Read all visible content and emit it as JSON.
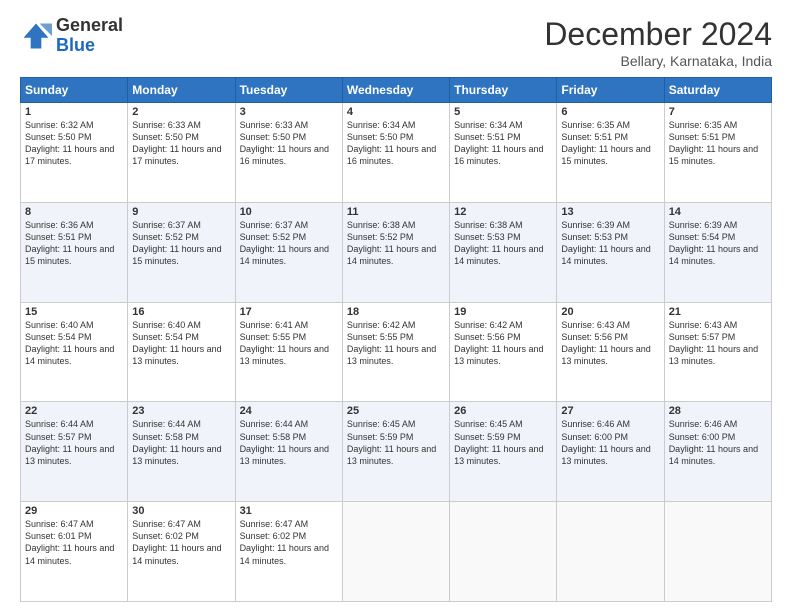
{
  "header": {
    "logo_line1": "General",
    "logo_line2": "Blue",
    "month_title": "December 2024",
    "subtitle": "Bellary, Karnataka, India"
  },
  "days_of_week": [
    "Sunday",
    "Monday",
    "Tuesday",
    "Wednesday",
    "Thursday",
    "Friday",
    "Saturday"
  ],
  "weeks": [
    [
      {
        "day": 1,
        "rise": "6:32 AM",
        "set": "5:50 PM",
        "daylight": "11 hours and 17 minutes."
      },
      {
        "day": 2,
        "rise": "6:33 AM",
        "set": "5:50 PM",
        "daylight": "11 hours and 17 minutes."
      },
      {
        "day": 3,
        "rise": "6:33 AM",
        "set": "5:50 PM",
        "daylight": "11 hours and 16 minutes."
      },
      {
        "day": 4,
        "rise": "6:34 AM",
        "set": "5:50 PM",
        "daylight": "11 hours and 16 minutes."
      },
      {
        "day": 5,
        "rise": "6:34 AM",
        "set": "5:51 PM",
        "daylight": "11 hours and 16 minutes."
      },
      {
        "day": 6,
        "rise": "6:35 AM",
        "set": "5:51 PM",
        "daylight": "11 hours and 15 minutes."
      },
      {
        "day": 7,
        "rise": "6:35 AM",
        "set": "5:51 PM",
        "daylight": "11 hours and 15 minutes."
      }
    ],
    [
      {
        "day": 8,
        "rise": "6:36 AM",
        "set": "5:51 PM",
        "daylight": "11 hours and 15 minutes."
      },
      {
        "day": 9,
        "rise": "6:37 AM",
        "set": "5:52 PM",
        "daylight": "11 hours and 15 minutes."
      },
      {
        "day": 10,
        "rise": "6:37 AM",
        "set": "5:52 PM",
        "daylight": "11 hours and 14 minutes."
      },
      {
        "day": 11,
        "rise": "6:38 AM",
        "set": "5:52 PM",
        "daylight": "11 hours and 14 minutes."
      },
      {
        "day": 12,
        "rise": "6:38 AM",
        "set": "5:53 PM",
        "daylight": "11 hours and 14 minutes."
      },
      {
        "day": 13,
        "rise": "6:39 AM",
        "set": "5:53 PM",
        "daylight": "11 hours and 14 minutes."
      },
      {
        "day": 14,
        "rise": "6:39 AM",
        "set": "5:54 PM",
        "daylight": "11 hours and 14 minutes."
      }
    ],
    [
      {
        "day": 15,
        "rise": "6:40 AM",
        "set": "5:54 PM",
        "daylight": "11 hours and 14 minutes."
      },
      {
        "day": 16,
        "rise": "6:40 AM",
        "set": "5:54 PM",
        "daylight": "11 hours and 13 minutes."
      },
      {
        "day": 17,
        "rise": "6:41 AM",
        "set": "5:55 PM",
        "daylight": "11 hours and 13 minutes."
      },
      {
        "day": 18,
        "rise": "6:42 AM",
        "set": "5:55 PM",
        "daylight": "11 hours and 13 minutes."
      },
      {
        "day": 19,
        "rise": "6:42 AM",
        "set": "5:56 PM",
        "daylight": "11 hours and 13 minutes."
      },
      {
        "day": 20,
        "rise": "6:43 AM",
        "set": "5:56 PM",
        "daylight": "11 hours and 13 minutes."
      },
      {
        "day": 21,
        "rise": "6:43 AM",
        "set": "5:57 PM",
        "daylight": "11 hours and 13 minutes."
      }
    ],
    [
      {
        "day": 22,
        "rise": "6:44 AM",
        "set": "5:57 PM",
        "daylight": "11 hours and 13 minutes."
      },
      {
        "day": 23,
        "rise": "6:44 AM",
        "set": "5:58 PM",
        "daylight": "11 hours and 13 minutes."
      },
      {
        "day": 24,
        "rise": "6:44 AM",
        "set": "5:58 PM",
        "daylight": "11 hours and 13 minutes."
      },
      {
        "day": 25,
        "rise": "6:45 AM",
        "set": "5:59 PM",
        "daylight": "11 hours and 13 minutes."
      },
      {
        "day": 26,
        "rise": "6:45 AM",
        "set": "5:59 PM",
        "daylight": "11 hours and 13 minutes."
      },
      {
        "day": 27,
        "rise": "6:46 AM",
        "set": "6:00 PM",
        "daylight": "11 hours and 13 minutes."
      },
      {
        "day": 28,
        "rise": "6:46 AM",
        "set": "6:00 PM",
        "daylight": "11 hours and 14 minutes."
      }
    ],
    [
      {
        "day": 29,
        "rise": "6:47 AM",
        "set": "6:01 PM",
        "daylight": "11 hours and 14 minutes."
      },
      {
        "day": 30,
        "rise": "6:47 AM",
        "set": "6:02 PM",
        "daylight": "11 hours and 14 minutes."
      },
      {
        "day": 31,
        "rise": "6:47 AM",
        "set": "6:02 PM",
        "daylight": "11 hours and 14 minutes."
      },
      null,
      null,
      null,
      null
    ]
  ]
}
